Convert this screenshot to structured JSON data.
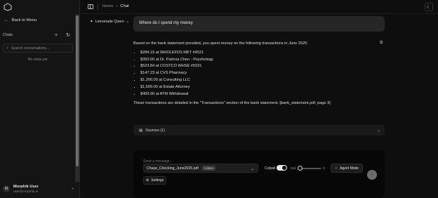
{
  "sidebar": {
    "back_label": "Back to Menu",
    "chats_title": "Chats",
    "search_placeholder": "Search conversations...",
    "empty_text": "No chats yet",
    "user": {
      "name": "Morphik User",
      "email": "user@morphik.ai",
      "initial": "M"
    }
  },
  "header": {
    "breadcrumb_home": "Home",
    "breadcrumb_current": "Chat"
  },
  "chat": {
    "model_name": "Lemonade Qwen",
    "user_message": "Where do I spend my money",
    "answer_intro": "Based on the bank statement provided, you spent money on the following transactions in June 2025:",
    "transactions": [
      "$284.15 at WHOLEFDS MKT #4521",
      "$350.00 at Dr. Patricia Chen - Psychology",
      "$523.84 at COSTCO WHSE #0231",
      "$147.23 at CVS Pharmacy",
      "$1,200.00 at Consulting LLC",
      "$1,500.00 at Estate Attorney",
      "$400.00 at ATM Withdrawal"
    ],
    "answer_outro": "These transactions are detailed in the \"Transactions\" section of the bank statement. [bank_statement.pdf, page 3]",
    "sources_label": "Sources (1)"
  },
  "composer": {
    "placeholder": "Send a message...",
    "file_name": "Chase_Checking_June2025.pdf",
    "doc_badge": "1 docs",
    "colpali_label": "Colpali",
    "colpali_enabled": true,
    "slider_min_label": "0sd",
    "slider_value_label": "0",
    "agent_mode_label": "Agent Mode",
    "settings_label": "Settings"
  }
}
